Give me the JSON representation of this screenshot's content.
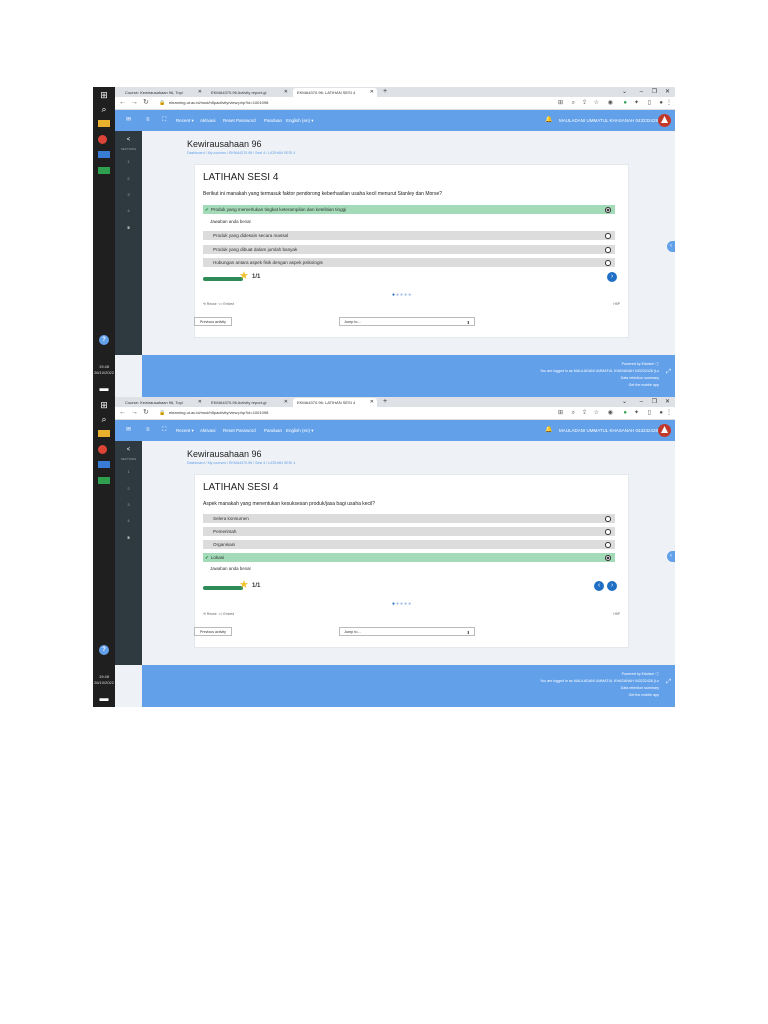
{
  "tabs": [
    {
      "label": "Course: Kewirausahaan 96, Topi"
    },
    {
      "label": "EKMA4370.96 Activity report-gi"
    },
    {
      "label": "EKMA4370.96: LATIHAN SESI 4"
    }
  ],
  "new_tab": "+",
  "window_controls": {
    "minimize": "–",
    "maximize": "❐",
    "close": "✕"
  },
  "url_1": "elearning.ut.ac.id/mod/h5pactivity/view.php?id=1001098",
  "url_2": "elearning.ut.ac.id/mod/h5pactivity/view.php?id=1001098",
  "nav": {
    "recent": "Recent ▾",
    "activity": "Aktivasi",
    "reset": "Reset Password",
    "guide": "Panduan",
    "language": "English (en) ▾",
    "user": "MAULADANI UMMATUL KHASANAH 043232428"
  },
  "drawer": {
    "close": "<",
    "label": "SECTIONS",
    "items": [
      "1",
      "2",
      "3",
      "4",
      "5"
    ]
  },
  "course_title": "Kewirausahaan 96",
  "breadcrumb": "Dashboard  /  My courses  /  EKMA4370.96  /  Sesi 4  /  LATIHAN SESI 4",
  "page_title": "LATIHAN SESI 4",
  "q1": {
    "question": "Berikut ini manakah yang termasuk faktor pendorong keberhasilan usaha kecil menurut Stanley dan Morse?",
    "correct": "Produk yang memerlukan tingkat keterampilan dan ketelitian tinggi",
    "feedback": "Jawaban anda benar",
    "options": [
      "Produk yang didesain secara massal",
      "Produk yang dibuat dalam jumlah banyak",
      "Hubungan antara aspek fisik dengan aspek psikologis"
    ],
    "score": "1/1",
    "progress": 1.0
  },
  "q2": {
    "question": "Aspek manakah yang menentukan kesuksesan produk/jasa bagi usaha kecil?",
    "options": [
      "Selera konsumen",
      "Pemerintah",
      "Organisasi"
    ],
    "correct": "Lokasi",
    "feedback": "Jawaban anda benar",
    "score": "1/1",
    "progress": 1.0
  },
  "card_footer": {
    "reuse": "⟲ Reuse",
    "embed": "<> Embed",
    "h5p": "H5P"
  },
  "prev_activity": "Previous activity",
  "jump_to": "Jump to...",
  "footer": {
    "powered": "Powered by Edwiser ⓘ",
    "logged_in": "You are logged in as MAULADANI UMMATUL KHASANAH 043232428 (Lo",
    "data_retention": "Data retention summary",
    "mobile": "Get the mobile app"
  },
  "taskbar": {
    "time": "19:48",
    "date": "26/10/2022"
  },
  "colors": {
    "nav": "#62a0ea",
    "correct": "#a3dbb8",
    "button": "#1f6fc4",
    "drawer": "#2f3a40"
  }
}
